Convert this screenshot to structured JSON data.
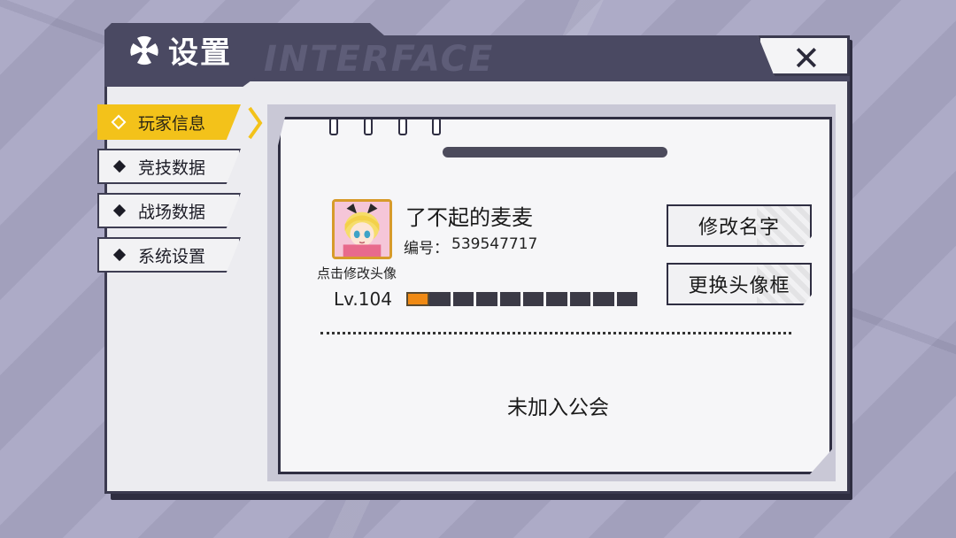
{
  "window": {
    "title": "设置",
    "watermark": "INTERFACE",
    "close_glyph": "✕"
  },
  "sidebar": {
    "items": [
      {
        "label": "玩家信息",
        "active": true
      },
      {
        "label": "竞技数据",
        "active": false
      },
      {
        "label": "战场数据",
        "active": false
      },
      {
        "label": "系统设置",
        "active": false
      }
    ]
  },
  "profile": {
    "name": "了不起的麦麦",
    "id_label": "编号：",
    "id_value": "539547717",
    "avatar_hint": "点击修改头像",
    "level_text": "Lv.104",
    "xp_progress": 0.1,
    "xp_segments": 10
  },
  "actions": {
    "rename_label": "修改名字",
    "change_frame_label": "更换头像框"
  },
  "guild": {
    "status": "未加入公会"
  },
  "colors": {
    "accent": "#f3c21a",
    "xp": "#f08a14",
    "frame": "#3b3a4f"
  },
  "icons": {
    "title": "radiation-icon",
    "close": "close-icon",
    "tab_active": "diamond-outline-icon",
    "tab_inactive": "diamond-icon",
    "arrow": "chevron-right-icon"
  }
}
